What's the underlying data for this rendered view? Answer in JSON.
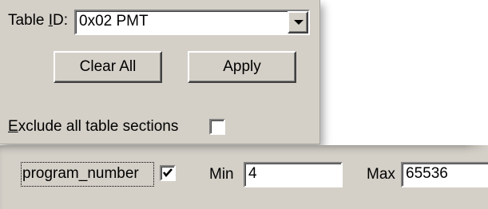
{
  "filter": {
    "table_id_label_prefix": "Table ",
    "table_id_label_ul": "I",
    "table_id_label_suffix": "D:",
    "table_id_value": "0x02 PMT",
    "clear_all_label": "Clear All",
    "apply_label": "Apply",
    "exclude_label_ul": "E",
    "exclude_label_rest": "xclude all table sections",
    "exclude_checked": false
  },
  "field_row": {
    "field_name": "program_number",
    "field_checked": true,
    "min_label": "Min",
    "min_value": "4",
    "max_label": "Max",
    "max_value": "65536"
  },
  "icons": {
    "dropdown": "chevron-down-icon",
    "check": "checkmark-icon"
  }
}
